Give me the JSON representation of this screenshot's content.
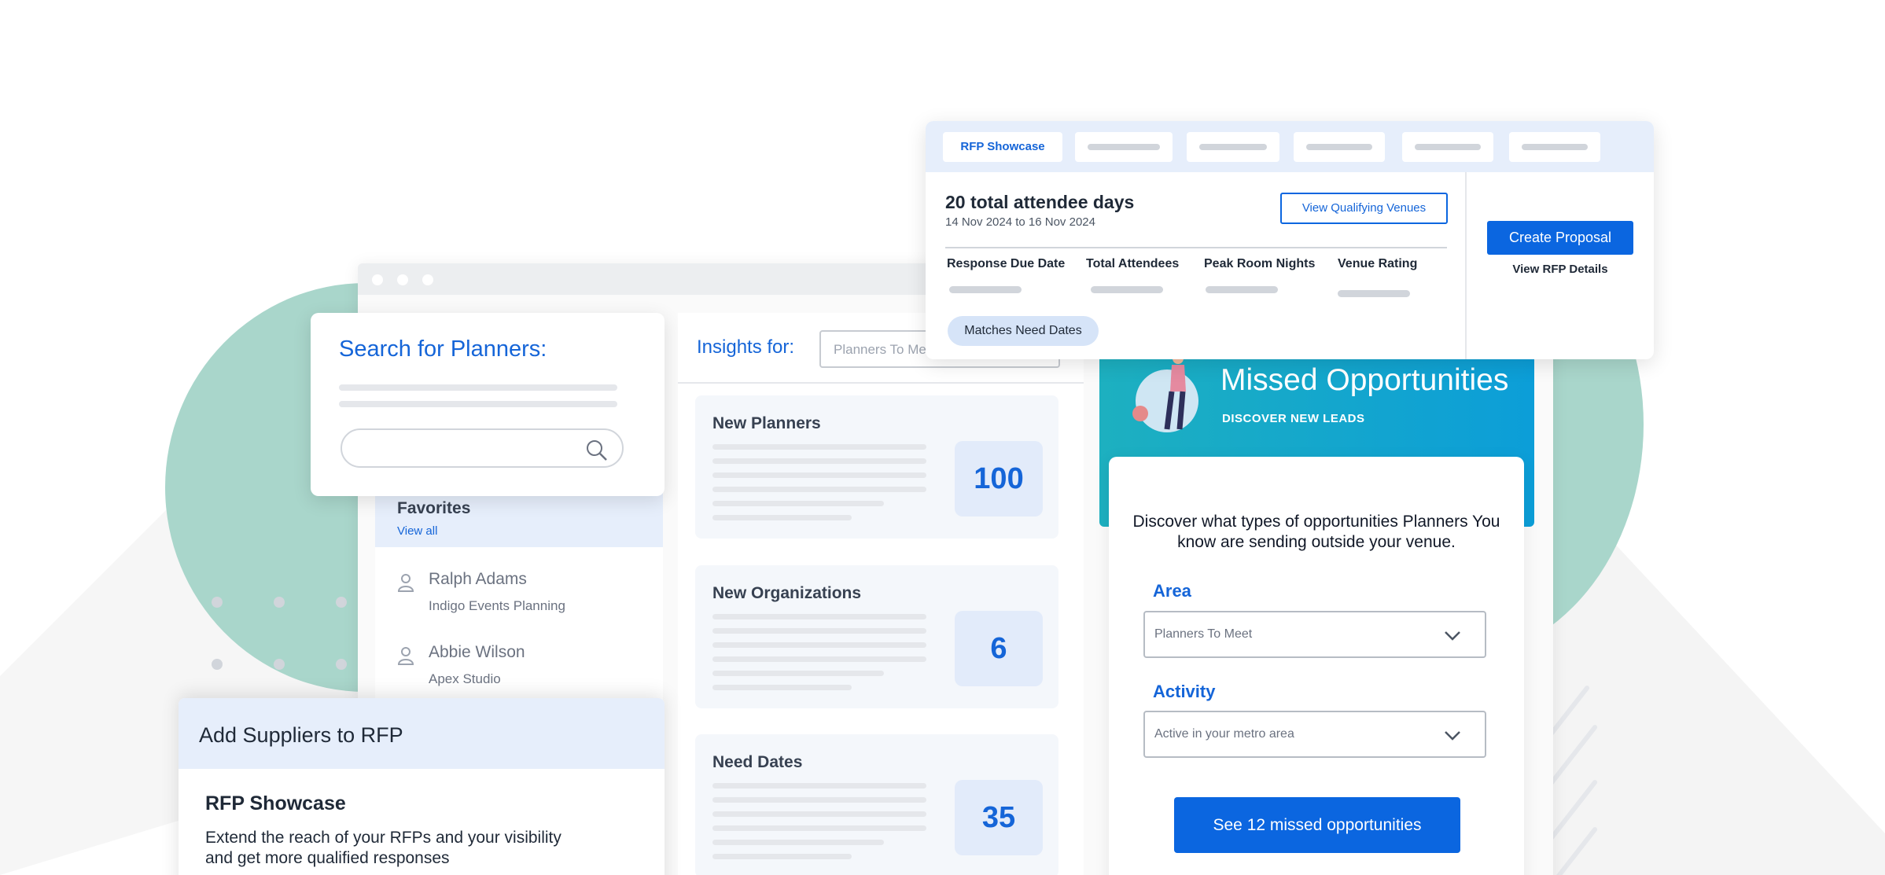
{
  "search": {
    "title": "Search for Planners:"
  },
  "favorites": {
    "title": "Favorites",
    "view_all": "View all",
    "planners": [
      {
        "name": "Ralph Adams",
        "org": "Indigo Events Planning"
      },
      {
        "name": "Abbie Wilson",
        "org": "Apex Studio"
      }
    ]
  },
  "insights": {
    "title": "Insights for:",
    "select_value": "Planners To Meet",
    "metrics": [
      {
        "label": "New Planners",
        "value": "100"
      },
      {
        "label": "New Organizations",
        "value": "6"
      },
      {
        "label": "Need Dates",
        "value": "35"
      }
    ]
  },
  "missed": {
    "title": "Missed Opportunities",
    "subtitle": "DISCOVER NEW LEADS",
    "description": "Discover what types of opportunities Planners You know are sending outside your venue.",
    "area_label": "Area",
    "area_value": "Planners To Meet",
    "activity_label": "Activity",
    "activity_value": "Active in your metro area",
    "button": "See 12 missed opportunities"
  },
  "rfp": {
    "active_tab": "RFP Showcase",
    "title": "20 total attendee days",
    "dates": "14 Nov 2024 to 16 Nov 2024",
    "qualifying_button": "View Qualifying Venues",
    "columns": [
      "Response Due Date",
      "Total Attendees",
      "Peak Room Nights",
      "Venue Rating"
    ],
    "pill": "Matches Need Dates",
    "create_button": "Create Proposal",
    "details_link": "View RFP Details"
  },
  "suppliers": {
    "title": "Add Suppliers to RFP",
    "subtitle": "RFP Showcase",
    "description": "Extend the reach of your RFPs and your visibility and get more qualified responses"
  },
  "colors": {
    "accent": "#1565d8",
    "button": "#0b66e0",
    "teal_blob": "#a9d6cb",
    "banner_start": "#1db0c0",
    "banner_end": "#0c9ed8"
  }
}
